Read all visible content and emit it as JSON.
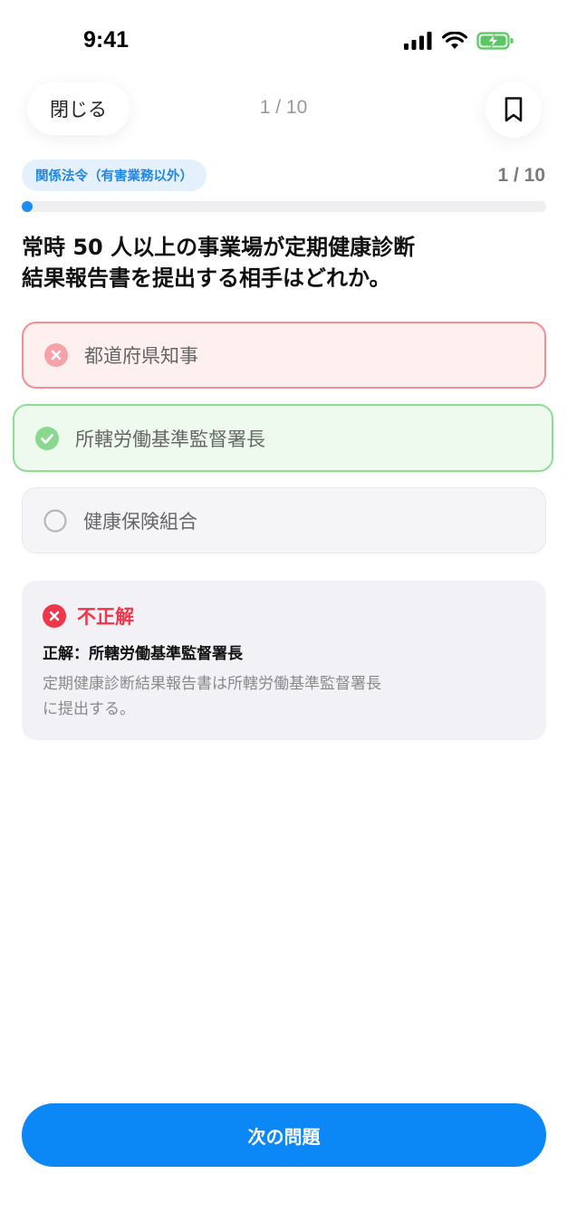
{
  "status_bar": {
    "time": "9:41"
  },
  "header": {
    "close_label": "閉じる",
    "counter": "1 / 10"
  },
  "quiz": {
    "category": "関係法令（有害業務以外）",
    "progress_text": "1 / 10",
    "progress_fraction": 0.1,
    "question_line1": "常時 50 人以上の事業場が定期健康診断",
    "question_line2": "結果報告書を提出する相手はどれか。",
    "options": [
      {
        "label": "都道府県知事",
        "state": "wrong"
      },
      {
        "label": "所轄労働基準監督署長",
        "state": "correct"
      },
      {
        "label": "健康保険組合",
        "state": "unselected"
      }
    ]
  },
  "feedback": {
    "result": "不正解",
    "answer": "正解：所轄労働基準監督署長",
    "explanation_line1": "定期健康診断結果報告書は所轄労働基準監督署長",
    "explanation_line2": "に提出する。"
  },
  "footer": {
    "next_label": "次の問題"
  },
  "colors": {
    "accent": "#0b87f6",
    "wrong": "#f0364a",
    "correct": "#5cc664"
  }
}
